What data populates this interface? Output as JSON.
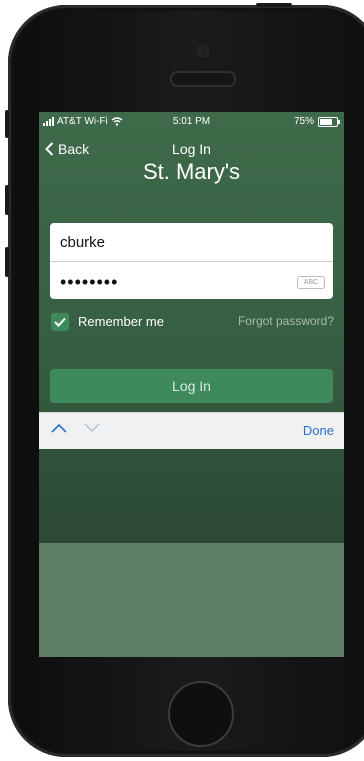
{
  "status_bar": {
    "carrier": "AT&T Wi-Fi",
    "time": "5:01 PM",
    "battery_text": "75%",
    "battery_level": 0.75
  },
  "nav": {
    "back_label": "Back",
    "title": "Log In"
  },
  "brand": {
    "name": "St. Mary's"
  },
  "form": {
    "username_value": "cburke",
    "password_value": "••••••••",
    "password_badge": "ABC",
    "remember_label": "Remember me",
    "remember_checked": true,
    "forgot_label": "Forgot password?",
    "login_label": "Log In"
  },
  "keyboard_toolbar": {
    "done_label": "Done"
  },
  "colors": {
    "accent": "#3f8a5b",
    "screen_bg": "#3f6a4a",
    "done_link": "#2a6fcc"
  }
}
